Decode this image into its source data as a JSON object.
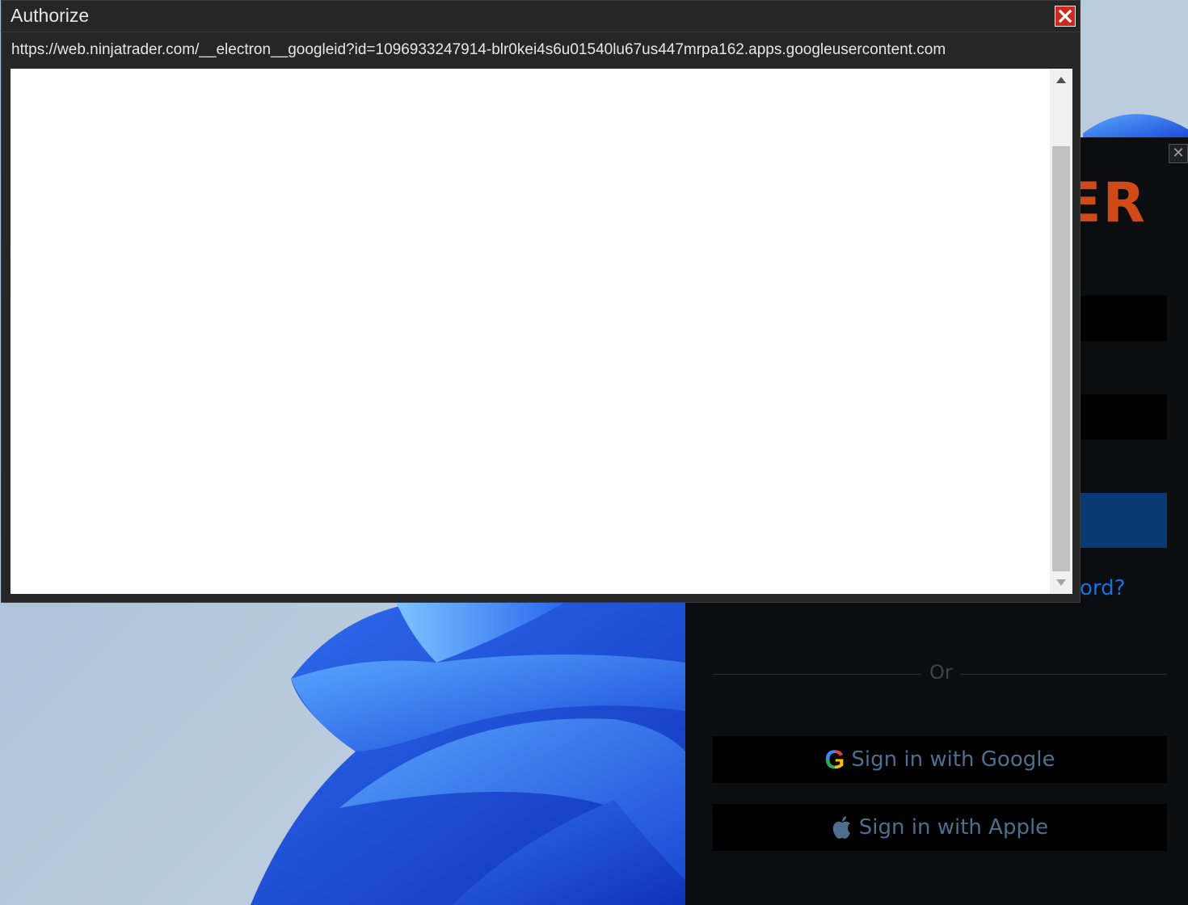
{
  "dialog": {
    "title": "Authorize",
    "url": "https://web.ninjatrader.com/__electron__googleid?id=1096933247914-blr0kei4s6u01540lu67us447mrpa162.apps.googleusercontent.com",
    "close_icon": "close-icon",
    "close_color": "#cc2a1f"
  },
  "login": {
    "logo_partial": "ER",
    "forgot_partial": "ord?",
    "or_label": "Or",
    "google_label": "Sign in with Google",
    "apple_label": "Sign in with Apple",
    "accent": "#cf4a17",
    "link_color": "#1a6fd8"
  }
}
